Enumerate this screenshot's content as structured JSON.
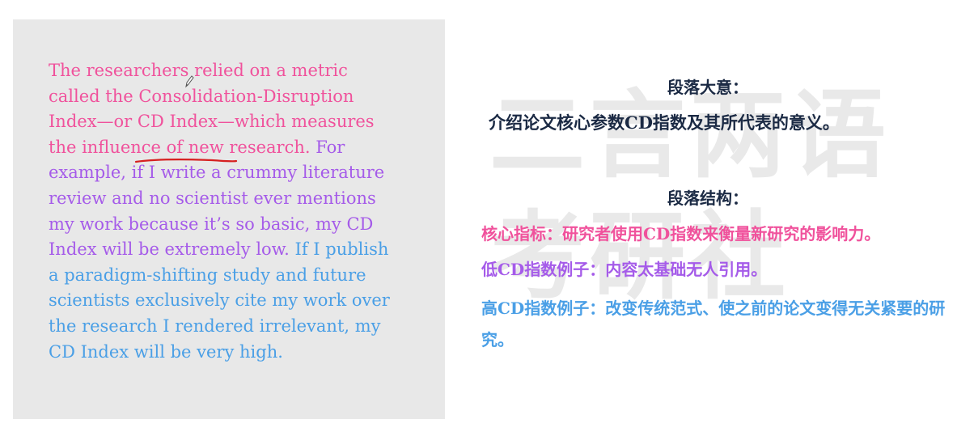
{
  "passage": {
    "lines": [
      {
        "text": "The researchers relied on a metric",
        "color": "#f0529c"
      },
      {
        "text": "called the Consolidation-Disruption",
        "color": "#f0529c"
      },
      {
        "text": "Index—or CD Index—which measures",
        "color": "#f0529c"
      },
      {
        "segments": [
          {
            "text": "the influence of new research. ",
            "color": "#f0529c"
          },
          {
            "text": "For",
            "color": "#a55be9"
          }
        ]
      },
      {
        "text": "example, if I write a crummy literature",
        "color": "#a55be9"
      },
      {
        "text": "review and no scientist ever mentions",
        "color": "#a55be9"
      },
      {
        "text": "my work because it’s so basic, my CD",
        "color": "#a55be9"
      },
      {
        "segments": [
          {
            "text": "Index will be extremely low. ",
            "color": "#a55be9"
          },
          {
            "text": "If I publish",
            "color": "#4a9fe6"
          }
        ]
      },
      {
        "text": "a paradigm-shifting study and future",
        "color": "#4a9fe6"
      },
      {
        "text": "scientists exclusively cite my work over",
        "color": "#4a9fe6"
      },
      {
        "text": "the research I rendered irrelevant, my",
        "color": "#4a9fe6"
      },
      {
        "text": "CD Index will be very high.",
        "color": "#4a9fe6"
      }
    ],
    "underline_color": "#d62020"
  },
  "watermark": {
    "line1": "二言两语",
    "line2": "考研社"
  },
  "analysis": {
    "main_idea_heading": "段落大意：",
    "main_idea_text": "介绍论文核心参数CD指数及其所代表的意义。",
    "structure_heading": "段落结构：",
    "points": [
      {
        "text": "核心指标：研究者使用CD指数来衡量新研究的影响力。",
        "color": "#f0529c"
      },
      {
        "text": "低CD指数例子：内容太基础无人引用。",
        "color": "#a55be9"
      },
      {
        "text": "高CD指数例子：改变传统范式、使之前的论文变得无关紧要的研究。",
        "color": "#4a9fe6"
      }
    ]
  }
}
